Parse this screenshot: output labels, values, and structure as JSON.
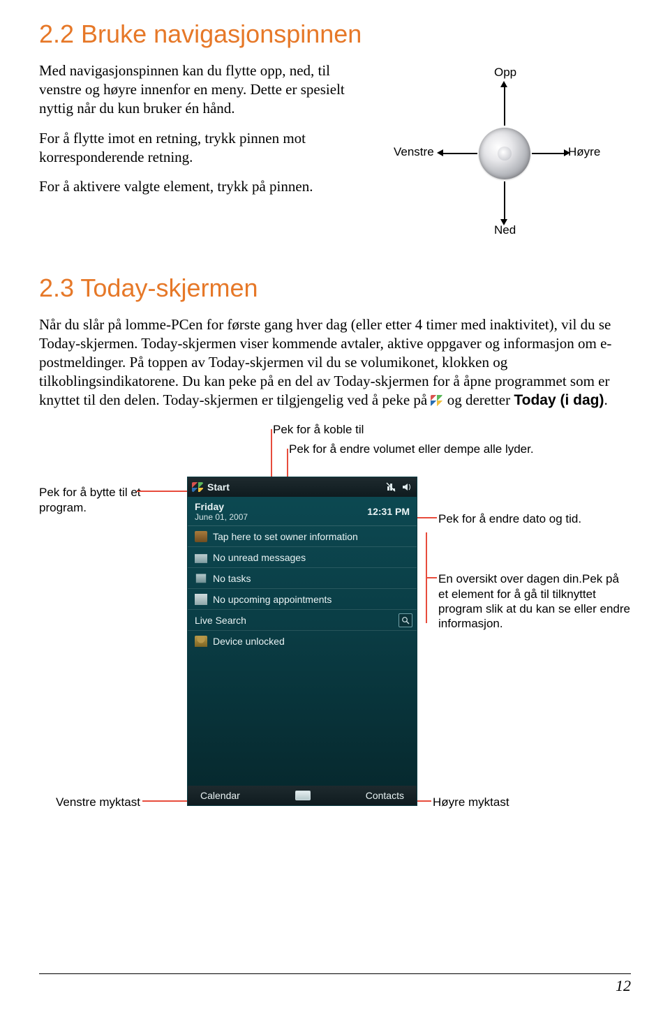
{
  "section22": {
    "title": "2.2  Bruke navigasjonspinnen",
    "p1": "Med navigasjonspinnen kan du flytte opp, ned, til venstre og høyre innenfor en meny. Dette er spesielt nyttig når du kun bruker én hånd.",
    "p2": "For å flytte imot en retning, trykk pinnen mot korresponderende retning.",
    "p3": "For å aktivere valgte element, trykk på pinnen."
  },
  "navpad": {
    "up": "Opp",
    "down": "Ned",
    "left": "Venstre",
    "right": "Høyre"
  },
  "section23": {
    "title": "2.3  Today-skjermen",
    "para_a": "Når du slår på lomme-PCen for første gang hver dag (eller etter 4 timer med inaktivitet), vil du se Today-skjermen. Today-skjermen viser kommende avtaler, aktive oppgaver og informasjon om e-postmeldinger. På toppen av Today-skjermen vil du se volumikonet, klokken og tilkoblingsindikatorene. Du kan peke på en del av Today-skjermen for å åpne programmet som er knyttet til den delen. Today-skjermen er tilgjengelig ved å peke på ",
    "para_b": " og deretter ",
    "today_bold": "Today (i dag)",
    "period": "."
  },
  "callouts": {
    "connect": "Pek for å koble til",
    "volume": "Pek for å endre volumet eller dempe alle lyder.",
    "switch": "Pek for å bytte til et program.",
    "datetime": "Pek for å endre dato og tid.",
    "overview": "En oversikt over dagen din.Pek på et element for å gå til tilknyttet program slik at du kan se eller endre informasjon.",
    "leftsoft": "Venstre myktast",
    "rightsoft": "Høyre myktast"
  },
  "device": {
    "start": "Start",
    "day": "Friday",
    "date": "June 01, 2007",
    "time": "12:31 PM",
    "owner": "Tap here to set owner information",
    "unread": "No unread messages",
    "tasks": "No tasks",
    "appts": "No upcoming appointments",
    "livesearch": "Live Search",
    "unlocked": "Device unlocked",
    "soft_left": "Calendar",
    "soft_right": "Contacts"
  },
  "page_number": "12"
}
